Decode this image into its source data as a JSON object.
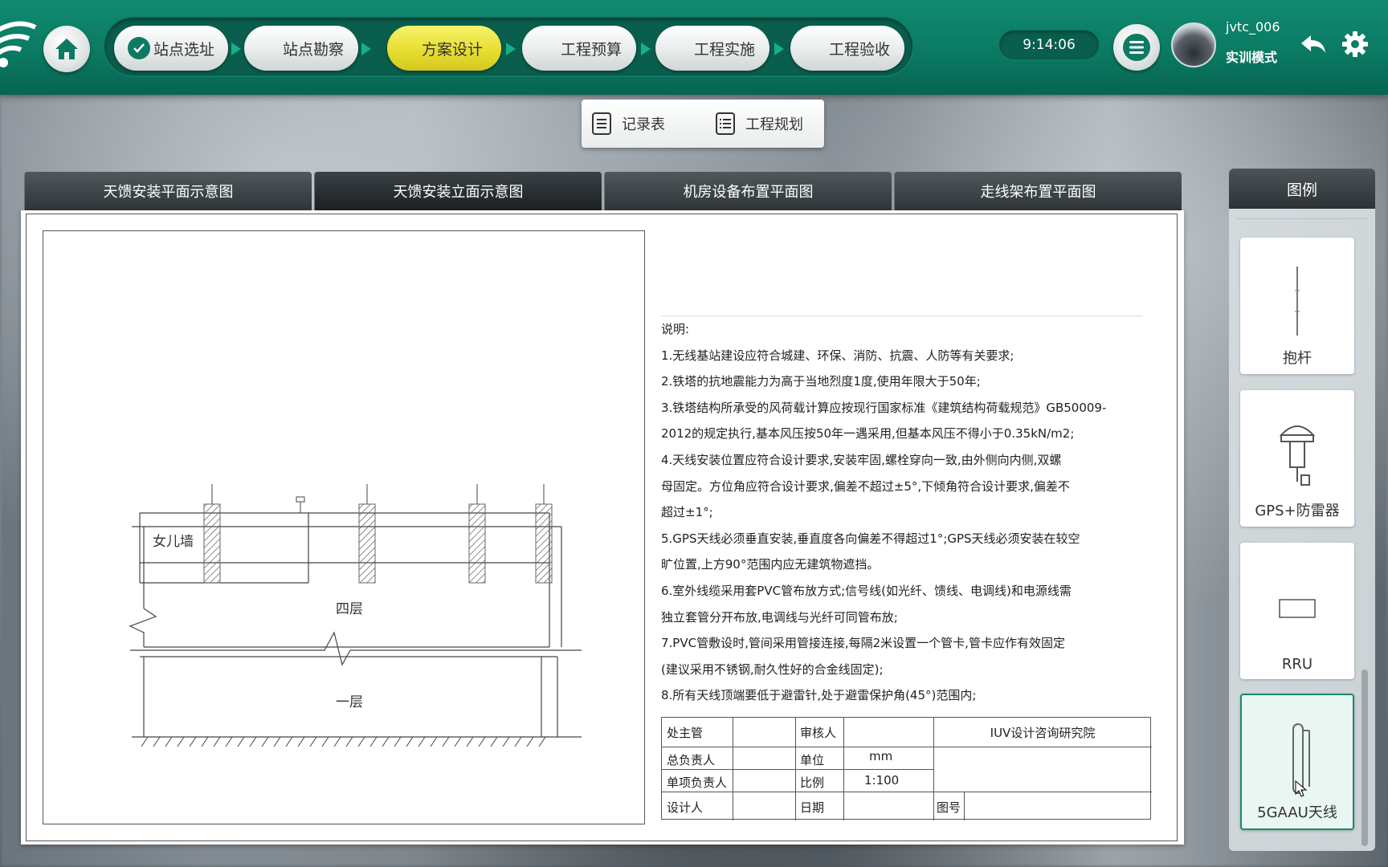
{
  "topbar": {
    "steps": [
      {
        "label": "站点选址",
        "state": "done"
      },
      {
        "label": "站点勘察",
        "state": "normal"
      },
      {
        "label": "方案设计",
        "state": "active"
      },
      {
        "label": "工程预算",
        "state": "normal"
      },
      {
        "label": "工程实施",
        "state": "normal"
      },
      {
        "label": "工程验收",
        "state": "normal"
      }
    ],
    "clock": "9:14:06",
    "user": {
      "name": "jvtc_006",
      "mode": "实训模式"
    },
    "colors": {
      "bar": "#0b7a63",
      "active_step": "#e6dc2e"
    }
  },
  "record_panel": {
    "items": [
      "记录表",
      "工程规划"
    ]
  },
  "drawing_tabs": [
    "天馈安装平面示意图",
    "天馈安装立面示意图",
    "机房设备布置平面图",
    "走线架布置平面图"
  ],
  "active_drawing_tab": "天馈安装立面示意图",
  "sketch": {
    "labels": {
      "parapet": "女儿墙",
      "floor4": "四层",
      "floor1": "一层"
    }
  },
  "notes": {
    "heading": "说明:",
    "lines": [
      "1.无线基站建设应符合城建、环保、消防、抗震、人防等有关要求;",
      "2.铁塔的抗地震能力为高于当地烈度1度,使用年限大于50年;",
      "3.铁塔结构所承受的风荷载计算应按现行国家标准《建筑结构荷载规范》GB50009-",
      "2012的规定执行,基本风压按50年一遇采用,但基本风压不得小于0.35kN/m2;",
      "4.天线安装位置应符合设计要求,安装牢固,螺栓穿向一致,由外侧向内侧,双螺",
      "母固定。方位角应符合设计要求,偏差不超过±5°,下倾角符合设计要求,偏差不",
      "超过±1°;",
      "5.GPS天线必须垂直安装,垂直度各向偏差不得超过1°;GPS天线必须安装在较空",
      "旷位置,上方90°范围内应无建筑物遮挡。",
      "6.室外线缆采用套PVC管布放方式;信号线(如光纤、馈线、电调线)和电源线需",
      "独立套管分开布放,电调线与光纤可同管布放;",
      "7.PVC管敷设时,管间采用管接连接,每隔2米设置一个管卡,管卡应作有效固定",
      "(建议采用不锈钢,耐久性好的合金线固定);",
      "8.所有天线顶端要低于避雷针,处于避雷保护角(45°)范围内;"
    ]
  },
  "title_block": {
    "chief": "处主管",
    "reviewer": "审核人",
    "institute": "IUV设计咨询研究院",
    "general_lead": "总负责人",
    "unit_label": "单位",
    "unit_value": "mm",
    "item_lead": "单项负责人",
    "scale_label": "比例",
    "scale_value": "1:100",
    "designer": "设计人",
    "date_label": "日期",
    "drawing_no": "图号"
  },
  "legend": {
    "title": "图例",
    "items": [
      {
        "label": "抱杆",
        "icon": "pole-icon"
      },
      {
        "label": "GPS+防雷器",
        "icon": "gps-arrester-icon"
      },
      {
        "label": "RRU",
        "icon": "rru-icon"
      },
      {
        "label": "5GAAU天线",
        "icon": "aau-antenna-icon",
        "selected": true
      }
    ]
  }
}
